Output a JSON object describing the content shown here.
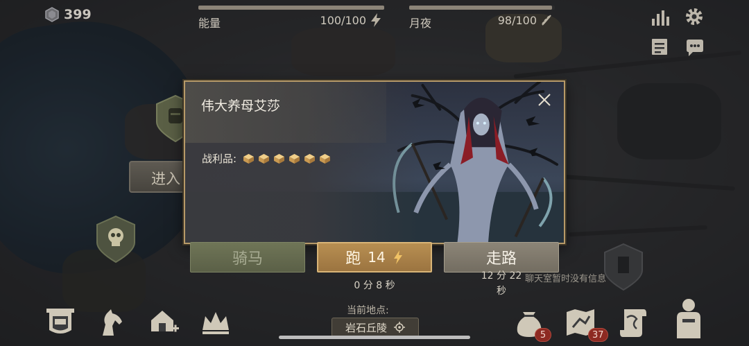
{
  "status": {
    "gems": "399"
  },
  "energy": {
    "label": "能量",
    "value": "100/100",
    "fill_fraction": 1.0
  },
  "moon": {
    "label": "月夜",
    "value": "98/100",
    "fill_fraction": 0.98
  },
  "map": {
    "enter_label": "进入"
  },
  "dialog": {
    "title": "伟大养母艾莎",
    "loot_label": "战利品:",
    "loot_count": 6
  },
  "travel": {
    "horse": {
      "label": "骑马"
    },
    "run": {
      "label": "跑",
      "cost": "14",
      "time": "0 分 8 秒"
    },
    "walk": {
      "label": "走路",
      "time_line1": "12 分 22",
      "time_line2": "秒"
    }
  },
  "chat": {
    "empty_text": "聊天室暂时没有信息"
  },
  "location": {
    "caption": "当前地点:",
    "name": "岩石丘陵"
  },
  "bottom_bar": {
    "bag_badge": "5",
    "map_badge": "37"
  },
  "colors": {
    "accent_gold": "#b79a68",
    "run_button": "#b88f52",
    "badge_red": "#8d2a22"
  }
}
